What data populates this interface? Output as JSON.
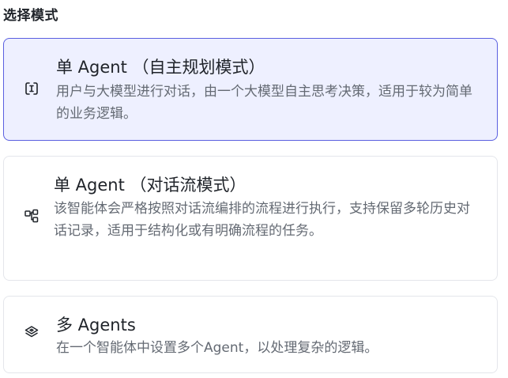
{
  "section": {
    "title": "选择模式"
  },
  "modes": [
    {
      "title": "单 Agent （自主规划模式）",
      "description": "用户与大模型进行对话，由一个大模型自主思考决策，适用于较为简单的业务逻辑。",
      "icon": "bracket-cursor-icon",
      "selected": true
    },
    {
      "title": "单 Agent （对话流模式）",
      "description": "该智能体会严格按照对话流编排的流程进行执行，支持保留多轮历史对话记录，适用于结构化或有明确流程的任务。",
      "icon": "workflow-icon",
      "selected": false
    },
    {
      "title": "多 Agents",
      "description": "在一个智能体中设置多个Agent，以处理复杂的逻辑。",
      "icon": "layers-icon",
      "selected": false
    }
  ],
  "colors": {
    "selected_border": "#5a5fe0",
    "selected_background": "#eef0ff",
    "border": "#e4e6eb",
    "title_text": "#1f2329",
    "description_text": "#646a73"
  }
}
